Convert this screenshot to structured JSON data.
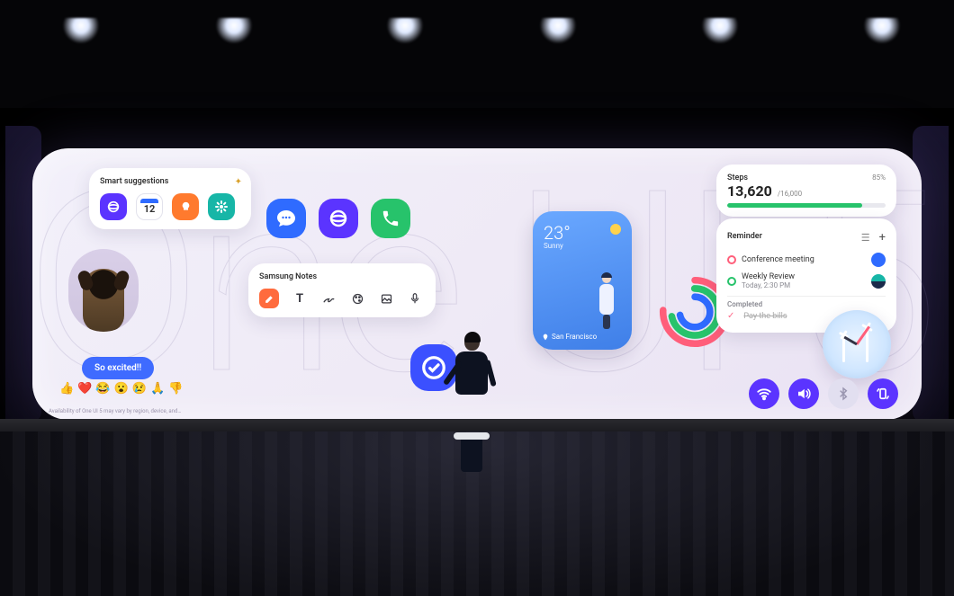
{
  "background_text": "One UI 5",
  "smart_suggestions": {
    "title": "Smart suggestions",
    "icons": [
      "browser",
      "calendar-12",
      "tips-bulb",
      "settings-flower"
    ]
  },
  "photo_subject": "small-dog",
  "chat_bubble": "So excited!!",
  "emoji_reactions": [
    "👍",
    "❤️",
    "😂",
    "😮",
    "😢",
    "🙏",
    "👎"
  ],
  "footnote_text": "Availability of One UI 5 may vary by region, device, and…",
  "app_icons": [
    "messages",
    "internet",
    "phone"
  ],
  "samsung_notes": {
    "title": "Samsung Notes",
    "tools": [
      "highlighter",
      "text",
      "pen",
      "palette",
      "image",
      "voice"
    ]
  },
  "check_icon": "task-check",
  "weather": {
    "temp": "23°",
    "condition": "Sunny",
    "location": "San Francisco"
  },
  "health_rings": [
    "move",
    "exercise",
    "stand"
  ],
  "steps": {
    "title": "Steps",
    "count": "13,620",
    "goal": "/16,000",
    "percent": 85,
    "percent_label": "85%"
  },
  "reminder": {
    "title": "Reminder",
    "items": [
      {
        "label": "Conference meeting",
        "color": "#ff5e7a",
        "dot": "#2f6bff"
      },
      {
        "label": "Weekly Review",
        "sub": "Today, 2:30 PM",
        "color": "#27c36b",
        "dot": "#1b2a4a"
      }
    ],
    "completed_header": "Completed",
    "completed": "Pay the bills"
  },
  "watch_face": "wind-turbine-scene",
  "quick_settings": [
    "wifi",
    "sound",
    "bluetooth",
    "rotate"
  ],
  "colors": {
    "purple": "#5b34ff",
    "blue": "#2f6bff",
    "green": "#27c36b",
    "orange": "#ff7a2e",
    "teal": "#17b6a7"
  }
}
